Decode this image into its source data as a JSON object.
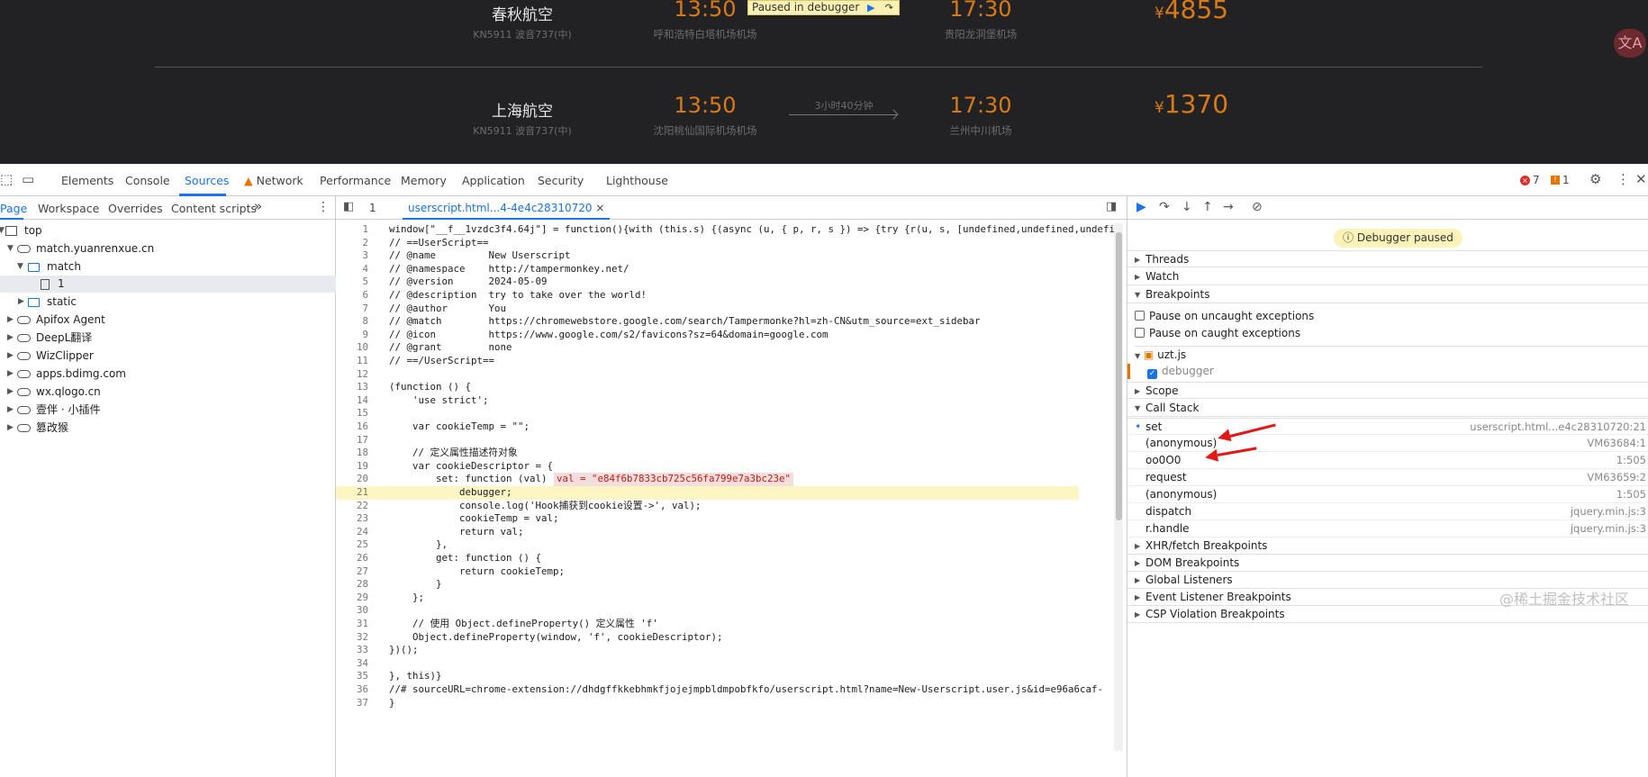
{
  "site": {
    "flights": [
      {
        "airline": "春秋航空",
        "plane": "KN5911 波音737(中)",
        "dep_time": "13:50",
        "dep_airport": "呼和浩特白塔机场机场",
        "duration": "",
        "arr_time": "17:30",
        "arr_airport": "贵阳龙洞堡机场",
        "currency": "¥",
        "price": "4855"
      },
      {
        "airline": "上海航空",
        "plane": "KN5911 波音737(中)",
        "dep_time": "13:50",
        "dep_airport": "沈阳桃仙国际机场机场",
        "duration": "3小时40分钟",
        "arr_time": "17:30",
        "arr_airport": "兰州中川机场",
        "currency": "¥",
        "price": "1370"
      }
    ],
    "paused_banner": "Paused in debugger",
    "translate_icon": "文A"
  },
  "devtools": {
    "tabs": [
      "Elements",
      "Console",
      "Sources",
      "Network",
      "Performance",
      "Memory",
      "Application",
      "Security",
      "Lighthouse"
    ],
    "active_tab": "Sources",
    "error_count": "7",
    "issue_count": "1",
    "navigator": {
      "tabs": [
        "Page",
        "Workspace",
        "Overrides",
        "Content scripts"
      ],
      "more": "»",
      "tree": [
        {
          "label": "top"
        },
        {
          "label": "match.yuanrenxue.cn"
        },
        {
          "label": "match"
        },
        {
          "label": "1"
        },
        {
          "label": "static"
        },
        {
          "label": "Apifox Agent"
        },
        {
          "label": "DeepL翻译"
        },
        {
          "label": "WizClipper"
        },
        {
          "label": "apps.bdimg.com"
        },
        {
          "label": "wx.qlogo.cn"
        },
        {
          "label": "壹伴 · 小插件"
        },
        {
          "label": "篡改猴"
        }
      ]
    },
    "editor": {
      "tab_number": "1",
      "file_tab": "userscript.html...4-4e4c28310720",
      "close": "×",
      "lines": [
        "window[\"__f__1vzdc3f4.64j\"] = function(){with (this.s) {(async (u, { p, r, s }) => {try {r(u, s, [undefined,undefined,undefi",
        "// ==UserScript==",
        "// @name         New Userscript",
        "// @namespace    http://tampermonkey.net/",
        "// @version      2024-05-09",
        "// @description  try to take over the world!",
        "// @author       You",
        "// @match        https://chromewebstore.google.com/search/Tampermonke?hl=zh-CN&utm_source=ext_sidebar",
        "// @icon         https://www.google.com/s2/favicons?sz=64&domain=google.com",
        "// @grant        none",
        "// ==/UserScript==",
        "",
        "(function () {",
        "    'use strict';",
        "",
        "    var cookieTemp = \"\";",
        "",
        "    // 定义属性描述符对象",
        "    var cookieDescriptor = {",
        "        set: function (val) {",
        "            debugger;",
        "            console.log('Hook捕获到cookie设置->', val);",
        "            cookieTemp = val;",
        "            return val;",
        "        },",
        "        get: function () {",
        "            return cookieTemp;",
        "        }",
        "    };",
        "",
        "    // 使用 Object.defineProperty() 定义属性 'f'",
        "    Object.defineProperty(window, 'f', cookieDescriptor);",
        "})();",
        "",
        "}, this)}",
        "//# sourceURL=chrome-extension://dhdgffkkebhmkfjojejmpbldmpobfkfo/userscript.html?name=New-Userscript.user.js&id=e96a6caf-",
        "}"
      ],
      "inline_value": "val = \"e84f6b7833cb725c56fa799e7a3bc23e\"",
      "highlight_line": 21
    },
    "debugger": {
      "paused": "Debugger paused",
      "sections_top": [
        "Threads",
        "Watch",
        "Breakpoints"
      ],
      "pause_uncaught": "Pause on uncaught exceptions",
      "pause_caught": "Pause on caught exceptions",
      "bp_file": "uzt.js",
      "bp_item": "debugger",
      "scope": "Scope",
      "call_stack": "Call Stack",
      "stack": [
        {
          "fn": "set",
          "loc": "userscript.html...e4c28310720:21"
        },
        {
          "fn": "(anonymous)",
          "loc": "VM63684:1"
        },
        {
          "fn": "oo0O0",
          "loc": "1:505"
        },
        {
          "fn": "request",
          "loc": "VM63659:2"
        },
        {
          "fn": "(anonymous)",
          "loc": "1:505"
        },
        {
          "fn": "dispatch",
          "loc": "jquery.min.js:3"
        },
        {
          "fn": "r.handle",
          "loc": "jquery.min.js:3"
        }
      ],
      "sections_bottom": [
        "XHR/fetch Breakpoints",
        "DOM Breakpoints",
        "Global Listeners",
        "Event Listener Breakpoints",
        "CSP Violation Breakpoints"
      ]
    }
  },
  "watermark": "@稀土掘金技术社区",
  "colors": {
    "accent": "#1a73e8",
    "price": "#d87a16",
    "annotation": "#e21818"
  }
}
